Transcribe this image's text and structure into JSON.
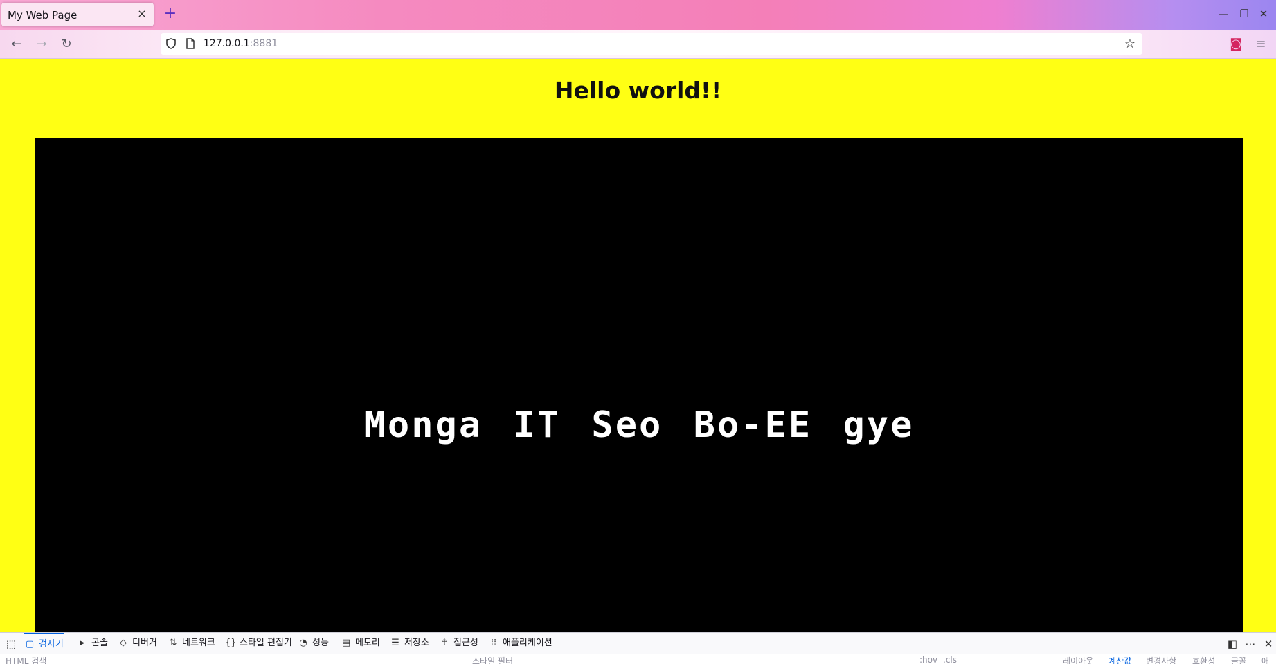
{
  "browser": {
    "tab_title": "My Web Page",
    "tab_close": "×",
    "new_tab": "+",
    "window_controls": {
      "minimize": "—",
      "restore": "❐",
      "close": "✕"
    },
    "nav": {
      "back": "←",
      "forward": "→",
      "reload": "↻"
    },
    "url_host": "127.0.0.1",
    "url_port": ":8881",
    "bookmark_star": "☆",
    "pocket": "◙",
    "menu": "≡"
  },
  "page": {
    "heading": "Hello world!!",
    "canvas_text": "Monga IT Seo Bo-EE gye",
    "background_color": "#ffff14",
    "canvas_color": "#000000"
  },
  "devtools": {
    "tabs": [
      {
        "label": "검사기",
        "icon": "inspector-icon",
        "glyph": "▢",
        "active": true
      },
      {
        "label": "콘솔",
        "icon": "console-icon",
        "glyph": "▸",
        "active": false
      },
      {
        "label": "디버거",
        "icon": "debugger-icon",
        "glyph": "◇",
        "active": false
      },
      {
        "label": "네트워크",
        "icon": "network-icon",
        "glyph": "⇅",
        "active": false
      },
      {
        "label": "스타일 편집기",
        "icon": "style-editor-icon",
        "glyph": "{}",
        "active": false
      },
      {
        "label": "성능",
        "icon": "performance-icon",
        "glyph": "◔",
        "active": false
      },
      {
        "label": "메모리",
        "icon": "memory-icon",
        "glyph": "▤",
        "active": false
      },
      {
        "label": "저장소",
        "icon": "storage-icon",
        "glyph": "☰",
        "active": false
      },
      {
        "label": "접근성",
        "icon": "accessibility-icon",
        "glyph": "☥",
        "active": false
      },
      {
        "label": "애플리케이션",
        "icon": "application-icon",
        "glyph": "⁞⁞",
        "active": false
      }
    ],
    "sub_toolbar": {
      "html_search_placeholder": "HTML 검색",
      "style_filter_placeholder": "스타일 필터",
      "pseudo_hov": ":hov",
      "cls": ".cls",
      "layout_tabs": [
        "레이아웃",
        "계산값",
        "변경사항",
        "호환성",
        "글꼴",
        "애"
      ]
    }
  }
}
